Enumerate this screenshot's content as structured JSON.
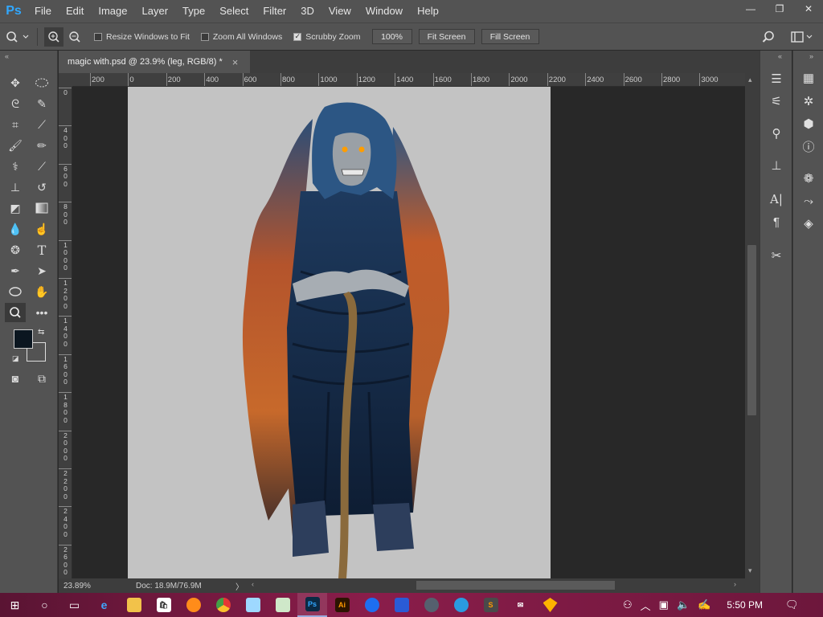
{
  "app": {
    "logo": "Ps",
    "name": "Photoshop"
  },
  "menu": [
    "File",
    "Edit",
    "Image",
    "Layer",
    "Type",
    "Select",
    "Filter",
    "3D",
    "View",
    "Window",
    "Help"
  ],
  "window_controls": {
    "minimize": "—",
    "restore": "❐",
    "close": "✕"
  },
  "options_bar": {
    "resize_windows_label": "Resize Windows to Fit",
    "resize_windows_checked": false,
    "zoom_all_label": "Zoom All Windows",
    "zoom_all_checked": false,
    "scrubby_zoom_label": "Scrubby Zoom",
    "scrubby_zoom_checked": true,
    "zoom_value": "100%",
    "fit_screen_label": "Fit Screen",
    "fill_screen_label": "Fill Screen"
  },
  "document_tab": {
    "title": "magic with.psd @ 23.9% (leg, RGB/8) *",
    "close": "×"
  },
  "ruler_h_labels": [
    "200",
    "0",
    "200",
    "400",
    "600",
    "800",
    "1000",
    "1200",
    "1400",
    "1600",
    "1800",
    "2000",
    "2200",
    "2400",
    "2600",
    "2800",
    "3000"
  ],
  "ruler_v_labels": [
    "0",
    "4\n0\n0",
    "6\n0\n0",
    "8\n0\n0",
    "1\n0\n0\n0",
    "1\n2\n0\n0",
    "1\n4\n0\n0",
    "1\n6\n0\n0",
    "1\n8\n0\n0",
    "2\n0\n0\n0",
    "2\n2\n0\n0",
    "2\n4\n0\n0",
    "2\n6\n0\n0"
  ],
  "status": {
    "zoom": "23.89%",
    "doc_size": "Doc: 18.9M/76.9M",
    "arrow": "〉"
  },
  "colors": {
    "foreground": "#0b1620",
    "background": "#ffffff",
    "canvas_bg": "#c3c3c3",
    "accent": "#31a8ff"
  },
  "taskbar": {
    "clock": "5:50 PM",
    "pinned": [
      "start-windows-icon",
      "cortana-circle-icon",
      "task-view-icon",
      "edge-icon",
      "file-explorer-icon",
      "store-icon",
      "firefox-icon",
      "chrome-icon",
      "notepad-icon",
      "spreadsheet-icon",
      "photoshop-icon",
      "illustrator-icon",
      "firefox-dev-icon",
      "virtualbox-icon",
      "game-icon",
      "globe-icon",
      "sublime-icon",
      "mail-icon",
      "sketch-icon"
    ],
    "tile_labels": {
      "photoshop": "Ps",
      "illustrator": "Ai"
    }
  }
}
